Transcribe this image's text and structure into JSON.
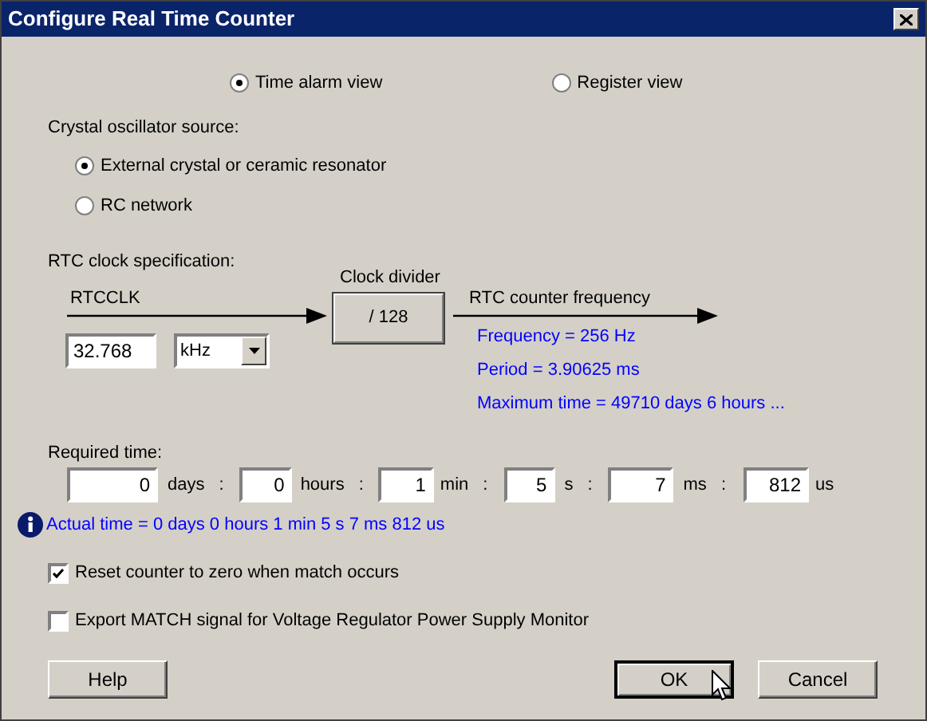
{
  "window": {
    "title": "Configure Real Time Counter"
  },
  "view_options": [
    {
      "label": "Time alarm view",
      "selected": true
    },
    {
      "label": "Register view",
      "selected": false
    }
  ],
  "oscillator": {
    "label": "Crystal oscillator source:",
    "options": [
      {
        "label": "External crystal or ceramic resonator",
        "selected": true
      },
      {
        "label": "RC network",
        "selected": false
      }
    ]
  },
  "clock_spec": {
    "label": "RTC clock specification:",
    "input_label": "RTCCLK",
    "frequency_value": "32.768",
    "unit": "kHz",
    "divider_label": "Clock divider",
    "divider": "/ 128",
    "output_label": "RTC counter frequency",
    "results": [
      "Frequency = 256 Hz",
      "Period = 3.90625 ms",
      "Maximum time = 49710 days 6 hours ..."
    ]
  },
  "required_time": {
    "label": "Required time:",
    "fields": [
      {
        "value": "0",
        "unit": "days",
        "separator": ":"
      },
      {
        "value": "0",
        "unit": "hours",
        "separator": ":"
      },
      {
        "value": "1",
        "unit": "min",
        "separator": ":"
      },
      {
        "value": "5",
        "unit": "s",
        "separator": ":"
      },
      {
        "value": "7",
        "unit": "ms",
        "separator": ":"
      },
      {
        "value": "812",
        "unit": "us"
      }
    ]
  },
  "actual_time": "Actual time = 0 days 0 hours 1 min 5 s 7 ms 812 us",
  "options": [
    {
      "label": "Reset counter to zero when match occurs",
      "checked": true
    },
    {
      "label": "Export MATCH signal for Voltage Regulator Power Supply Monitor",
      "checked": false
    }
  ],
  "buttons": [
    {
      "label": "Help",
      "default": false
    },
    {
      "label": "OK",
      "default": true
    },
    {
      "label": "Cancel",
      "default": false
    }
  ]
}
